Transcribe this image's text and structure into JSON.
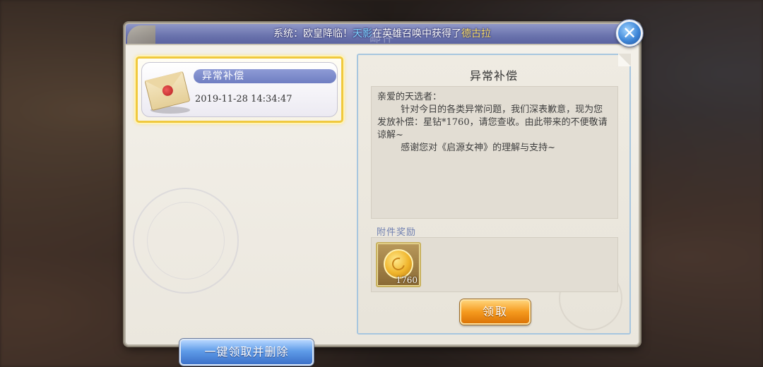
{
  "dialog": {
    "title": "邮件",
    "announcement": {
      "prefix": "系统：欧皇降临！",
      "player": "天影",
      "middle": "在英雄召唤中获得了",
      "hero": "德古拉"
    }
  },
  "mail_list": {
    "items": [
      {
        "subject": "异常补偿",
        "date": "2019-11-28  14:34:47",
        "icon": "envelope-icon",
        "selected": true
      }
    ],
    "claim_all_label": "一键领取并删除"
  },
  "mail_detail": {
    "title": "异常补偿",
    "body": "亲爱的天选者：\n        针对今日的各类异常问题，我们深表歉意，现为您发放补偿：星钻*1760，请您查收。由此带来的不便敬请谅解~\n        感谢您对《启源女神》的理解与支持~",
    "attachment_label": "附件奖励",
    "rewards": [
      {
        "icon": "star-diamond-coin-icon",
        "quantity": "1760"
      }
    ],
    "claim_label": "领取"
  },
  "colors": {
    "header": "#6a73ad",
    "selected_border": "#f0c93e",
    "claim_all": "#3b70c8",
    "claim": "#f59a1e",
    "highlight_player": "#7fd3ff",
    "highlight_hero": "#ffe36a"
  }
}
